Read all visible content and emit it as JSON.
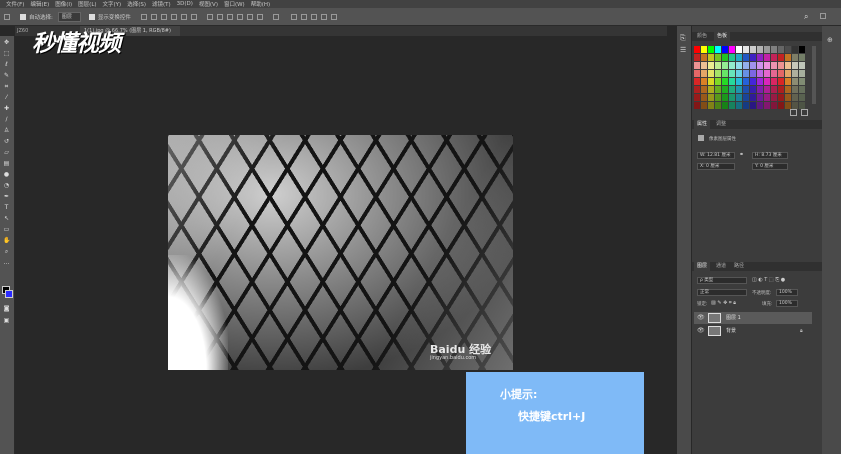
{
  "menu": [
    "文件(F)",
    "编辑(E)",
    "图像(I)",
    "图层(L)",
    "文字(Y)",
    "选择(S)",
    "滤镜(T)",
    "3D(D)",
    "视图(V)",
    "窗口(W)",
    "帮助(H)"
  ],
  "options": {
    "auto_select_label": "自动选择:",
    "auto_select_value": "图层",
    "show_transform_label": "显示变换控件"
  },
  "tabs": {
    "tab1": "JZ60",
    "tab2": "1(1).jpg @ 66.7% (图层 1, RGB/8#)"
  },
  "logo": "秒懂视频",
  "document": {
    "watermark": "Baidu 经验",
    "watermark_url": "jingyan.baidu.com"
  },
  "hint": {
    "title": "小提示:",
    "body": "快捷键ctrl+J"
  },
  "panels": {
    "swatch_tabs": [
      "颜色",
      "色板"
    ],
    "prop_tabs": [
      "属性",
      "调整"
    ],
    "prop_title": "像素图层属性",
    "w": "W: 12.81 厘米",
    "h": "H: 8.73 厘米",
    "x": "X: 0 厘米",
    "y": "Y: 0 厘米",
    "layer_tabs": [
      "图层",
      "通道",
      "路径"
    ],
    "kind": "ρ 类型",
    "blend": "正常",
    "opacity_label": "不透明度:",
    "opacity": "100%",
    "lock_label": "锁定:",
    "fill_label": "填充:",
    "fill": "100%",
    "layers": [
      {
        "name": "图层 1"
      },
      {
        "name": "背景"
      }
    ]
  },
  "colors": {
    "accent": "#7fbaf7",
    "bg": "#282828",
    "panel": "#3c3c3c"
  }
}
